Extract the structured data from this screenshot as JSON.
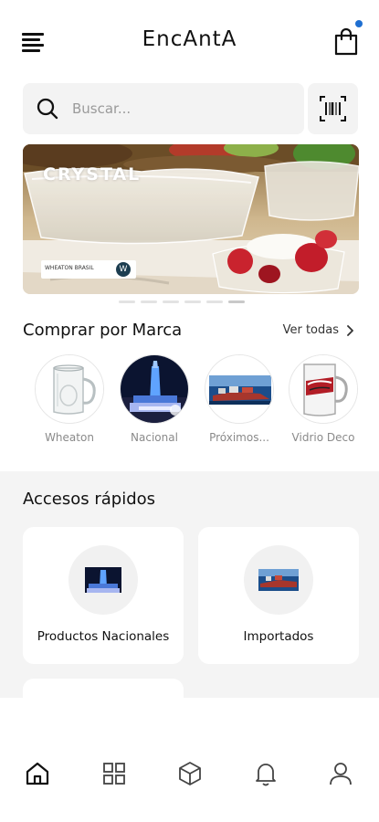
{
  "header": {
    "title": "EncAntA",
    "menu_icon": "hamburger-menu-icon",
    "cart_icon": "shopping-bag-icon",
    "cart_badge_color": "#1f6fd1"
  },
  "search": {
    "placeholder": "Buscar...",
    "value": "",
    "search_icon": "search-icon",
    "scan_icon": "barcode-scan-icon"
  },
  "banner": {
    "brand_text": "CRYSTAL",
    "logo_text": "WHEATON BRASIL",
    "logo_badge": "W",
    "slides_total": 6,
    "active_slide": 6
  },
  "brands": {
    "title": "Comprar por Marca",
    "see_all_label": "Ver todas",
    "items": [
      {
        "name": "Wheaton"
      },
      {
        "name": "Nacional"
      },
      {
        "name": "Próximos..."
      },
      {
        "name": "Vidrio Deco"
      }
    ]
  },
  "quick_access": {
    "title": "Accesos rápidos",
    "cards": [
      {
        "label": "Productos Nacionales"
      },
      {
        "label": "Importados"
      }
    ]
  },
  "nav": {
    "items": [
      {
        "icon": "home-icon",
        "active": true
      },
      {
        "icon": "grid-icon",
        "active": false
      },
      {
        "icon": "box-icon",
        "active": false
      },
      {
        "icon": "bell-icon",
        "active": false
      },
      {
        "icon": "user-icon",
        "active": false
      }
    ]
  }
}
